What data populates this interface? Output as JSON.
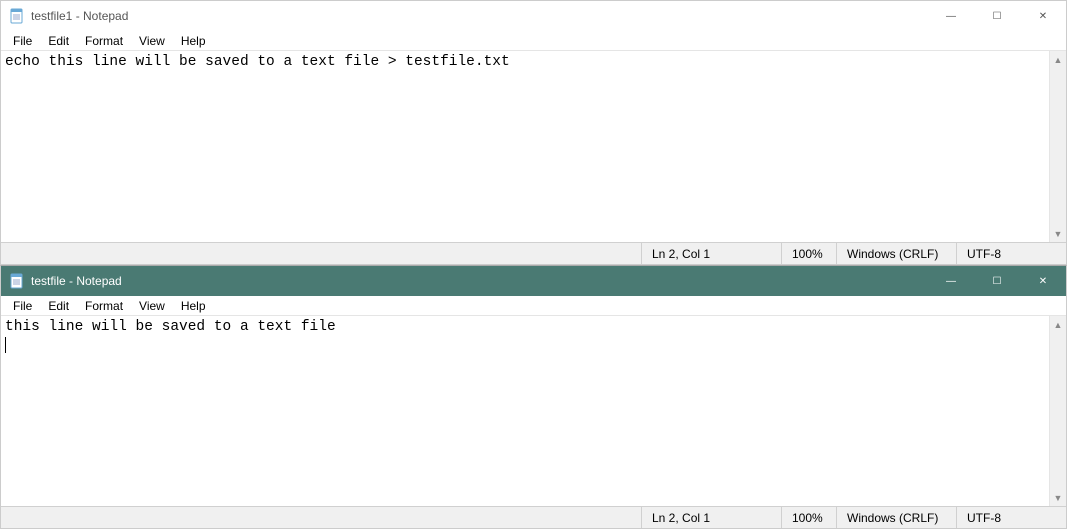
{
  "windows": [
    {
      "title": "testfile1 - Notepad",
      "active": false,
      "menu": [
        "File",
        "Edit",
        "Format",
        "View",
        "Help"
      ],
      "content": "echo this line will be saved to a text file > testfile.txt",
      "status": {
        "lncol": "Ln 2, Col 1",
        "zoom": "100%",
        "eol": "Windows (CRLF)",
        "encoding": "UTF-8"
      }
    },
    {
      "title": "testfile - Notepad",
      "active": true,
      "menu": [
        "File",
        "Edit",
        "Format",
        "View",
        "Help"
      ],
      "content": "this line will be saved to a text file",
      "status": {
        "lncol": "Ln 2, Col 1",
        "zoom": "100%",
        "eol": "Windows (CRLF)",
        "encoding": "UTF-8"
      }
    }
  ],
  "icons": {
    "notepad": "notepad-icon",
    "minimize": "—",
    "maximize": "☐",
    "close": "✕",
    "scroll_up": "▲",
    "scroll_down": "▼"
  }
}
